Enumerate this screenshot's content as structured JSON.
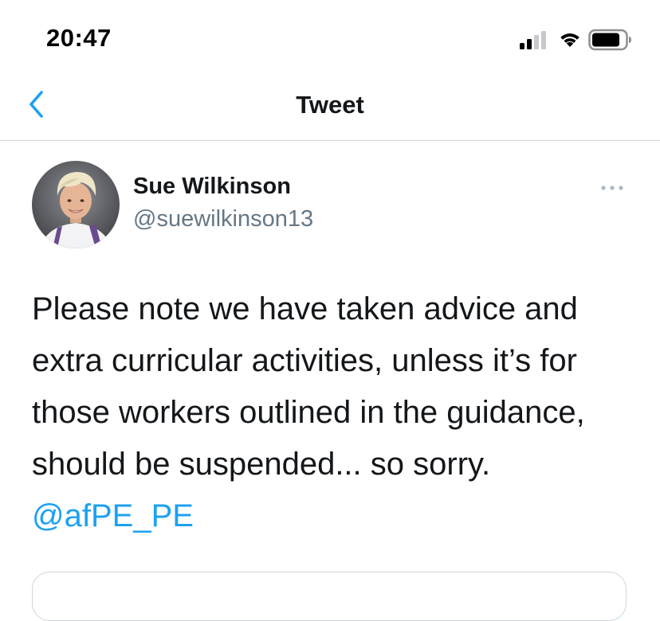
{
  "status_bar": {
    "time": "20:47"
  },
  "nav": {
    "title": "Tweet",
    "back_icon": "chevron-left-icon"
  },
  "tweet": {
    "author_name": "Sue Wilkinson",
    "author_handle": "@suewilkinson13",
    "text": "Please note we have taken advice and extra curricular activities, unless it’s for those workers outlined in the guidance, should be suspended... so sorry. ",
    "mention": "@afPE_PE",
    "more_icon": "more-dots-icon"
  },
  "colors": {
    "accent": "#1da1f2",
    "text": "#14171a",
    "secondary_text": "#657786",
    "divider": "#d5d9dc"
  }
}
